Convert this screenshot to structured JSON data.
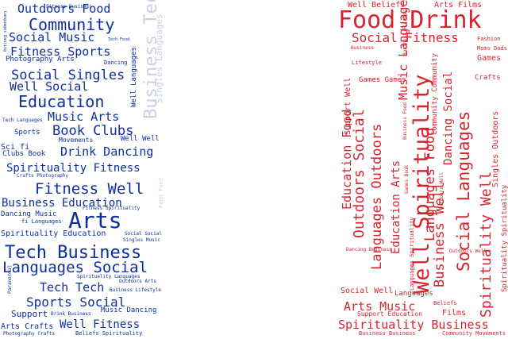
{
  "palette": {
    "left": "#0d2fa0",
    "left_faded": "#c9d0e4",
    "right": "#d8242f",
    "background": "#ffffff"
  },
  "left_cloud": {
    "color_name": "blue",
    "words": [
      "Outdoors Food",
      "Community",
      "Social Music",
      "Fitness Sports",
      "Social Singles",
      "Well Social",
      "Education",
      "Music Arts",
      "Book Clubs",
      "Drink Dancing",
      "Spirituality Fitness",
      "Fitness Well",
      "Business Education",
      "Arts",
      "Tech Business",
      "Languages Social",
      "Tech Tech",
      "Sports Social",
      "Well Fitness",
      "Business Tech",
      "Singles Languages",
      "Well Languages",
      "Well Well",
      "Sports",
      "Sci fi",
      "Clubs Book",
      "Movements",
      "Photography Arts",
      "Dancing Music",
      "fi Languages",
      "Spirituality Education",
      "Support",
      "Arts Crafts",
      "Music Dancing",
      "Tech Languages",
      "Fitness Business",
      "Dancing",
      "Tech Food",
      "Crafts Photography",
      "Languages Dancing",
      "Food Food",
      "Fitness Spirituality",
      "Social Social",
      "Singles Music",
      "Spirituality Languages",
      "Outdoors Arts",
      "Business Lifestyle",
      "Paranormal",
      "Drink Business",
      "Photography Crafts",
      "Beliefs Spirituality",
      "Music"
    ]
  },
  "right_cloud": {
    "color_name": "red",
    "words": [
      "Food Drink",
      "Well Beliefs",
      "Arts Films",
      "Social Fitness",
      "Spirituality",
      "Well Spirituality",
      "Social Languages",
      "Spirituality Well",
      "Outdoors Social",
      "Education Food",
      "Languages Outdoors",
      "Education Arts",
      "Languages Food",
      "Business Well",
      "Dancing Social",
      "Community Community",
      "Support Well",
      "Games",
      "Games Games",
      "Crafts",
      "Fashion",
      "Moms Dads",
      "Lifestyle",
      "Business",
      "Business Fitness",
      "Business Food",
      "Music Languages",
      "Singles Outdoors",
      "Social Well",
      "Arts Music",
      "Support Education",
      "Beliefs",
      "Films",
      "Spirituality Business",
      "Business Business",
      "Community Movements",
      "Languages",
      "Outdoors Well",
      "Spirituality Spirituality",
      "Dancing Business",
      "Games Book",
      "Languages Spirituality"
    ]
  }
}
